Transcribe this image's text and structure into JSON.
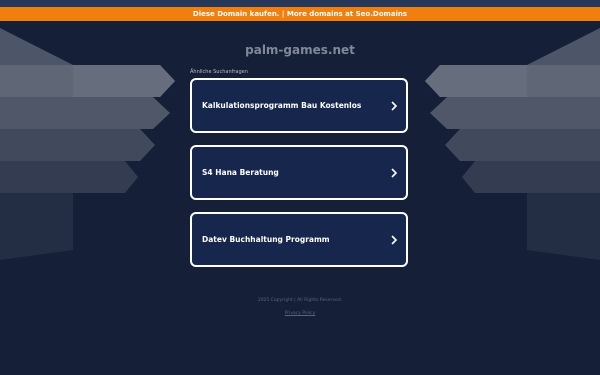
{
  "banner": {
    "text": "Diese Domain kaufen. | More domains at Seo.Domains"
  },
  "domain": "palm-games.net",
  "related_title": "Ähnliche Suchanfragen",
  "cards": [
    {
      "label": "Kalkulationsprogramm Bau Kostenlos",
      "icon": "chevron-right-icon"
    },
    {
      "label": "S4 Hana Beratung",
      "icon": "chevron-right-icon"
    },
    {
      "label": "Datev Buchhaltung Programm",
      "icon": "chevron-right-icon"
    }
  ],
  "footer": {
    "copyright": "2025 Copyright | All Rights Reserved.",
    "privacy": "Privacy Policy"
  },
  "colors": {
    "background": "#151f38",
    "banner": "#f07f0d",
    "card": "#17264d",
    "card_border": "#ffffff"
  }
}
